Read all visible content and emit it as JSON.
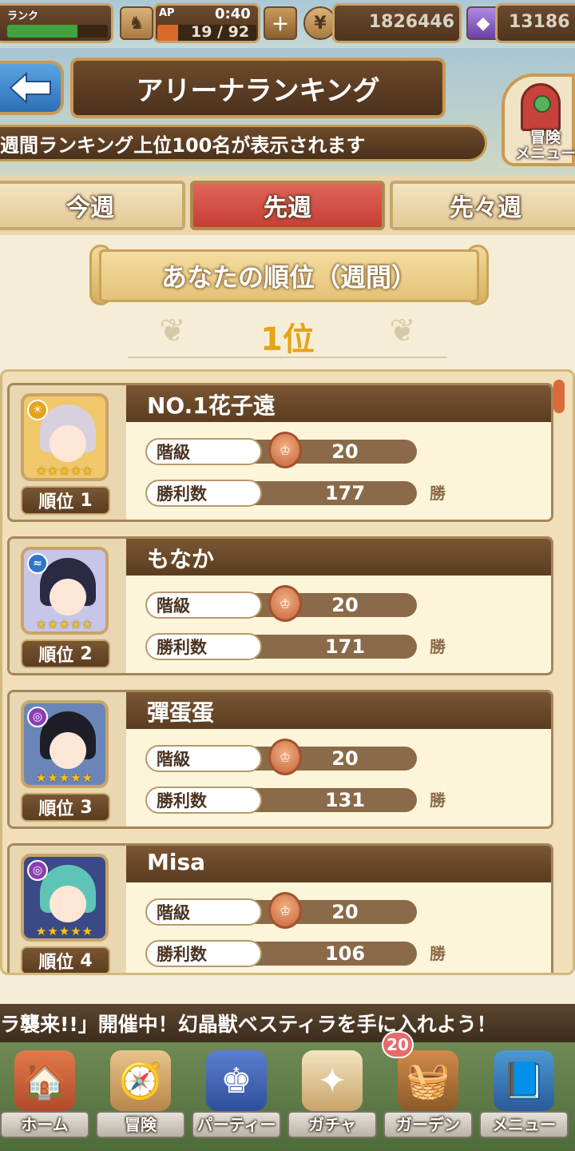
{
  "status_bar": {
    "rank_label": "ランク",
    "rank_progress": 0.7,
    "ap_label": "AP",
    "ap_timer": "0:40",
    "ap_value": "19 / 92",
    "ap_progress": 0.21,
    "gold": "1826446",
    "gems": "13186",
    "add_icon": "plus-icon",
    "gold_icon": "coin-icon",
    "gem_icon": "gem-icon"
  },
  "header": {
    "back_icon": "back-arrow-icon",
    "title": "アリーナランキング",
    "subtitle": "週間ランキング上位100名が表示されます",
    "adventure_menu_label": "冒険\nメニュー"
  },
  "tabs": [
    {
      "label": "今週",
      "active": false
    },
    {
      "label": "先週",
      "active": true
    },
    {
      "label": "先々週",
      "active": false
    }
  ],
  "your_rank": {
    "banner": "あなたの順位（週間）",
    "rank": "1位"
  },
  "ranking": {
    "rank_prefix": "順位",
    "grade_label": "階級",
    "wins_label": "勝利数",
    "wins_unit": "勝",
    "entries": [
      {
        "name": "NO.1花子遠",
        "rank": "1",
        "grade": "20",
        "wins": "177",
        "element": "light",
        "elem_color": "#e6a21a",
        "hair": "#d9d0de",
        "bg": "#f0c86a"
      },
      {
        "name": "もなか",
        "rank": "2",
        "grade": "20",
        "wins": "171",
        "element": "water",
        "elem_color": "#2f74c8",
        "hair": "#2a2a44",
        "bg": "#c8c6e8"
      },
      {
        "name": "彈蛋蛋",
        "rank": "3",
        "grade": "20",
        "wins": "131",
        "element": "dark",
        "elem_color": "#8a3fb5",
        "hair": "#1e1e28",
        "bg": "#6a86b8"
      },
      {
        "name": "Misa",
        "rank": "4",
        "grade": "20",
        "wins": "106",
        "element": "dark",
        "elem_color": "#8a3fb5",
        "hair": "#5fc4b8",
        "bg": "#3b4a86"
      }
    ]
  },
  "ticker": {
    "text": "ラ襲来!!」開催中！幻晶獣ベスティラを手に入れよう！"
  },
  "bottom_nav": {
    "garden_badge": "20",
    "items": [
      {
        "label": "ホーム",
        "icon": "house-icon"
      },
      {
        "label": "冒険",
        "icon": "map-icon"
      },
      {
        "label": "パーティー",
        "icon": "chess-icon"
      },
      {
        "label": "ガチャ",
        "icon": "gacha-icon"
      },
      {
        "label": "ガーデン",
        "icon": "garden-icon"
      },
      {
        "label": "メニュー",
        "icon": "book-icon"
      }
    ]
  }
}
